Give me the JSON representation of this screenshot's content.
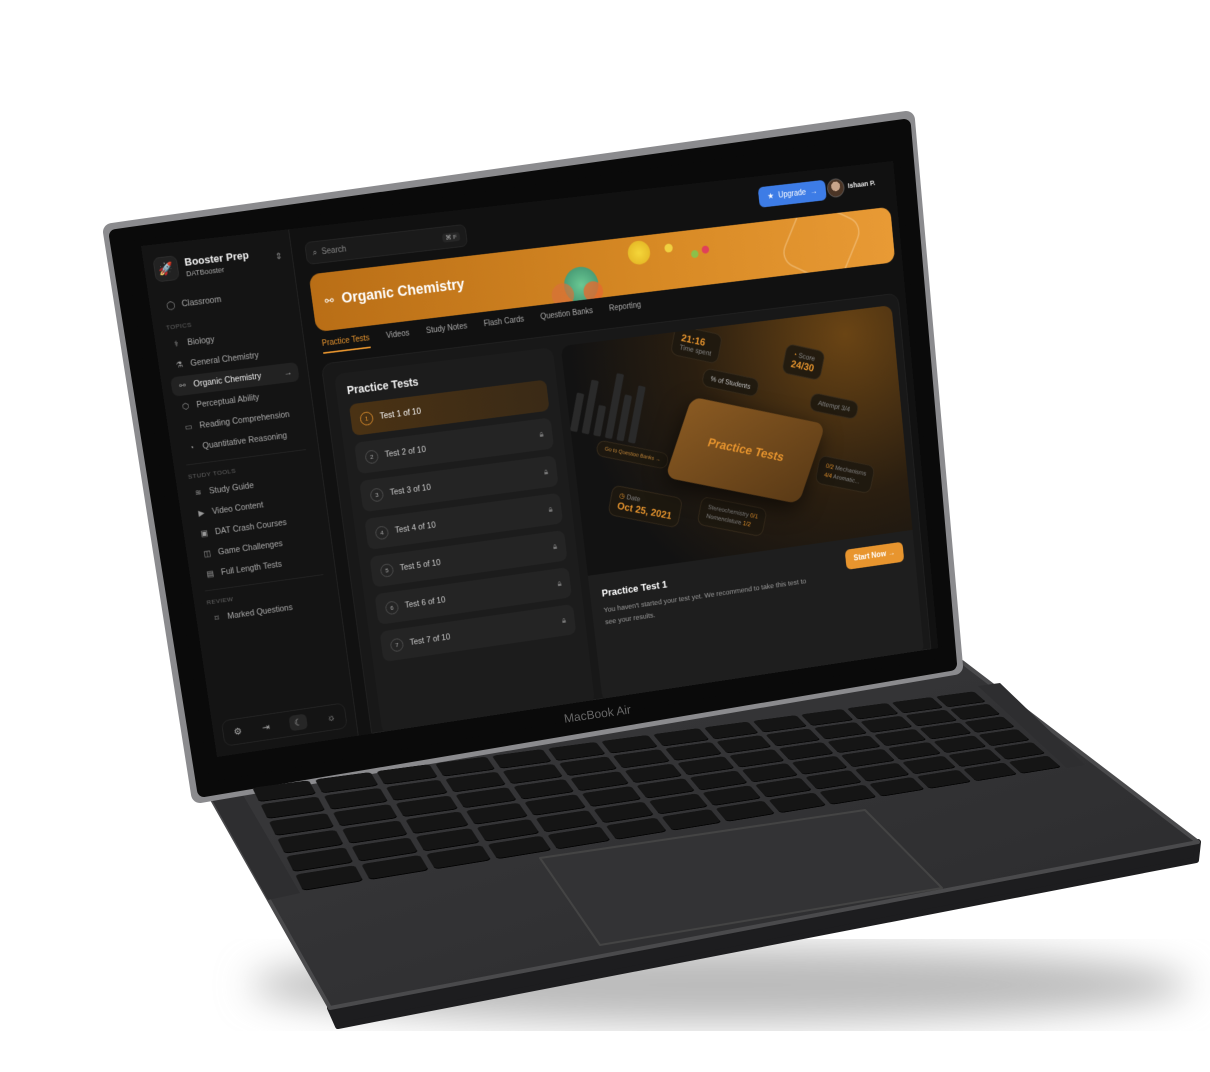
{
  "laptop_label": "MacBook Air",
  "sidebar": {
    "brand": "Booster Prep",
    "brand_sub": "DATBooster",
    "classroom": "Classroom",
    "topics_label": "TOPICS",
    "topics": [
      {
        "label": "Biology",
        "icon": "dna-icon"
      },
      {
        "label": "General Chemistry",
        "icon": "test-tube-icon"
      },
      {
        "label": "Organic Chemistry",
        "icon": "molecule-icon",
        "active": true
      },
      {
        "label": "Perceptual Ability",
        "icon": "cube-icon"
      },
      {
        "label": "Reading Comprehension",
        "icon": "book-icon"
      },
      {
        "label": "Quantitative Reasoning",
        "icon": "pie-chart-icon"
      }
    ],
    "tools_label": "STUDY TOOLS",
    "tools": [
      {
        "label": "Study Guide"
      },
      {
        "label": "Video Content"
      },
      {
        "label": "DAT Crash Courses"
      },
      {
        "label": "Game Challenges"
      },
      {
        "label": "Full Length Tests"
      }
    ],
    "review_label": "REVIEW",
    "review": [
      {
        "label": "Marked Questions"
      }
    ],
    "theme": "dark"
  },
  "header": {
    "search_placeholder": "Search",
    "search_shortcut": "⌘ F",
    "upgrade": "Upgrade",
    "user": "Ishaan P."
  },
  "banner": {
    "title": "Organic Chemistry"
  },
  "tabs": [
    {
      "label": "Practice Tests",
      "active": true
    },
    {
      "label": "Videos"
    },
    {
      "label": "Study Notes"
    },
    {
      "label": "Flash Cards"
    },
    {
      "label": "Question Banks"
    },
    {
      "label": "Reporting"
    }
  ],
  "practice": {
    "title": "Practice Tests",
    "tests": [
      {
        "num": "1",
        "label": "Test 1 of 10",
        "locked": false
      },
      {
        "num": "2",
        "label": "Test 2 of 10",
        "locked": true
      },
      {
        "num": "3",
        "label": "Test 3 of 10",
        "locked": true
      },
      {
        "num": "4",
        "label": "Test 4 of 10",
        "locked": true
      },
      {
        "num": "5",
        "label": "Test 5 of 10",
        "locked": true
      },
      {
        "num": "6",
        "label": "Test 6 of 10",
        "locked": true
      },
      {
        "num": "7",
        "label": "Test 7 of 10",
        "locked": true
      }
    ]
  },
  "preview": {
    "hero": "Practice Tests",
    "time": "21:16",
    "time_label": "Time spent",
    "score": "24/30",
    "score_label": "Score",
    "students": "% of Students",
    "attempt": "Attempt 3/4",
    "date_label": "Date",
    "date": "Oct 25, 2021",
    "topics": [
      "Stereochemistry",
      "Nomenclature",
      "Mechanisms",
      "Aromatic..."
    ],
    "fractions": [
      "0/2",
      "4/4",
      "1/2",
      "0/1"
    ],
    "qb_link": "Go to Question Banks →",
    "title": "Practice Test 1",
    "desc": "You haven't started your test yet. We recommend to take this test to see your results.",
    "cta": "Start Now →"
  },
  "colors": {
    "accent": "#e8952e",
    "upgrade": "#3d7ce6",
    "background": "#111111"
  }
}
